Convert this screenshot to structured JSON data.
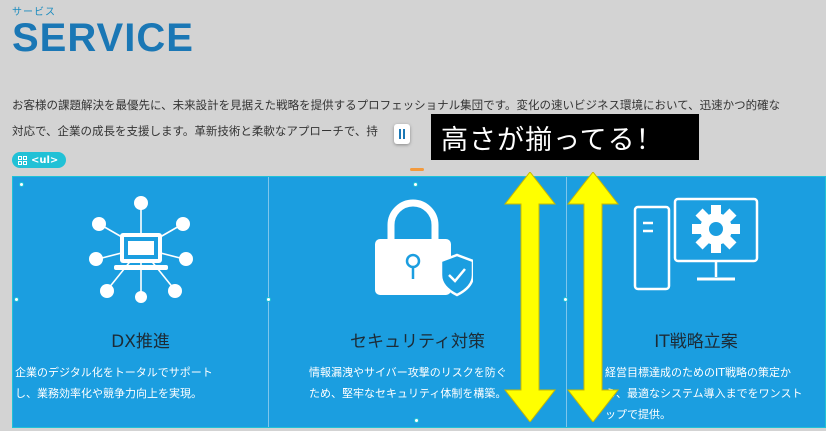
{
  "header": {
    "sub_label": "サービス",
    "title": "SERVICE"
  },
  "intro": {
    "line1": "お客様の課題解決を最優先に、未来設計を見据えた戦略を提供するプロフェッショナル集団です。変化の速いビジネス環境において、迅速かつ的確な",
    "line2": "対応で、企業の成長を支援します。革新技術と柔軟なアプローチで、持"
  },
  "editor": {
    "ul_badge": "<ul>",
    "overlay_text": "高さが揃ってる！"
  },
  "cards": [
    {
      "title": "DX推進",
      "desc_line1": "企業のデジタル化をトータルでサポート",
      "desc_line2": "し、業務効率化や競争力向上を実現。",
      "icon": "network-laptop-icon"
    },
    {
      "title": "セキュリティ対策",
      "desc_line1": "情報漏洩やサイバー攻撃のリスクを防ぐ",
      "desc_line2": "ため、堅牢なセキュリティ体制を構築。",
      "icon": "padlock-shield-icon"
    },
    {
      "title": "IT戦略立案",
      "desc_line1": "経営目標達成のためのIT戦略の策定か",
      "desc_line2": "ら、最適なシステム導入までをワンスト",
      "desc_line3": "ップで提供。",
      "icon": "computer-gear-icon"
    }
  ],
  "colors": {
    "accent": "#1a77b5",
    "card_bg": "#1b9ee0",
    "badge": "#21c1d6",
    "arrow": "#ffff00"
  }
}
